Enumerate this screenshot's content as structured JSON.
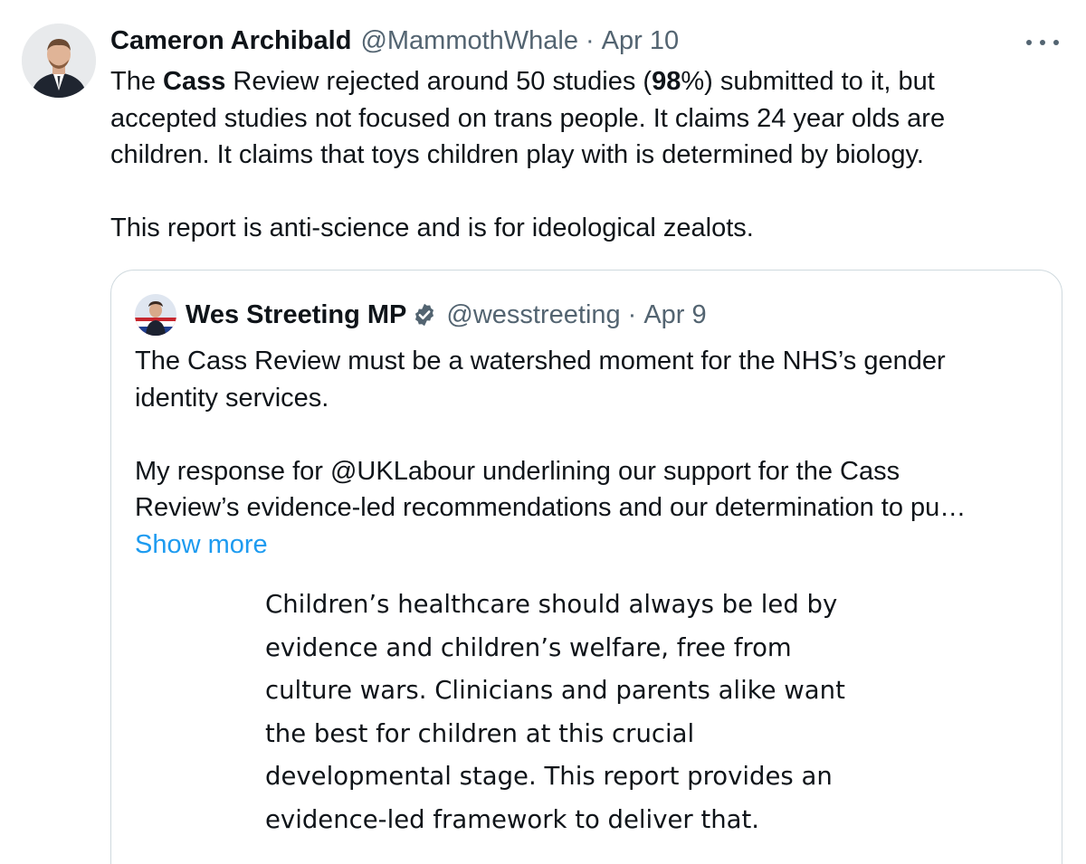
{
  "tweet": {
    "author_name": "Cameron Archibald",
    "handle": "@MammothWhale",
    "separator": "·",
    "date": "Apr 10",
    "text": {
      "line1_a": "The ",
      "line1_b": "Cass",
      "line1_c": " Review rejected around 50 studies (",
      "line1_d": "98",
      "line1_e": "%) submitted to it, but",
      "line2": "accepted studies not focused on trans people. It claims 24 year olds are",
      "line3": "children. It claims that toys children play with is determined by biology.",
      "line4": "This report is anti-science and is for ideological zealots."
    },
    "icons": {
      "more": "more-horizontal-icon",
      "avatar": "profile-photo"
    }
  },
  "quoted_tweet": {
    "author_name": "Wes Streeting MP",
    "verified": true,
    "handle": "@wesstreeting",
    "separator": "·",
    "date": "Apr 9",
    "text": {
      "line1": "The Cass Review must be a watershed moment for the NHS’s gender",
      "line2": "identity services.",
      "line3": "My response for @UKLabour underlining our support for the Cass",
      "line4": "Review’s evidence-led recommendations and our determination to pu…"
    },
    "show_more_label": "Show more",
    "statement_lines": [
      "Children’s healthcare should always be led by",
      "evidence and children’s welfare, free from",
      "culture wars. Clinicians and parents alike want",
      "the best for children at this crucial",
      "developmental stage. This report provides an",
      "evidence-led framework to deliver that."
    ],
    "colors": {
      "link": "#1d9bf0",
      "verified_badge": "#536471"
    }
  },
  "colors": {
    "text_primary": "#0f1419",
    "text_secondary": "#536471",
    "border": "#cfd9de"
  }
}
